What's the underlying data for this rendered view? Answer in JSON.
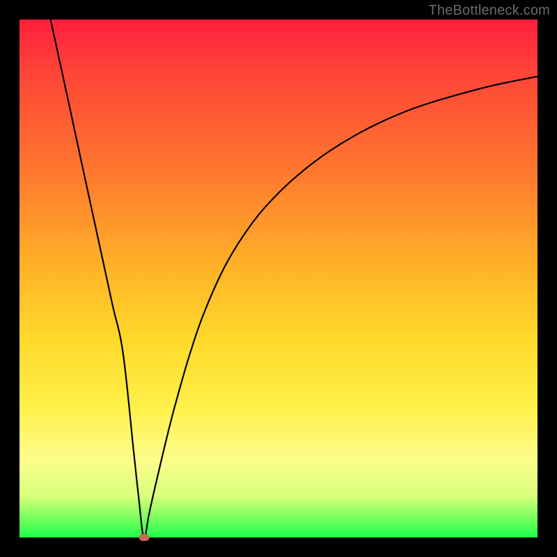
{
  "attribution": "TheBottleneck.com",
  "colors": {
    "frame": "#000000",
    "grad_top": "#ff1f3d",
    "grad_bottom": "#1bff4a",
    "curve": "#000000",
    "marker": "#cc6658"
  },
  "chart_data": {
    "type": "line",
    "title": "",
    "xlabel": "",
    "ylabel": "",
    "x_range": [
      0,
      100
    ],
    "y_range": [
      0,
      100
    ],
    "marker": {
      "x": 24,
      "y": 0
    },
    "series": [
      {
        "name": "bottleneck-curve",
        "x": [
          6,
          8,
          10,
          12,
          14,
          16,
          18,
          20,
          22,
          23,
          24,
          25,
          26,
          28,
          30,
          33,
          36,
          40,
          45,
          50,
          55,
          60,
          66,
          72,
          78,
          85,
          92,
          100
        ],
        "y": [
          100,
          90.8,
          81.6,
          72.3,
          63.1,
          53.9,
          44.7,
          35.5,
          17.0,
          7.8,
          0,
          4.5,
          9.0,
          17.5,
          25.4,
          35.8,
          44.3,
          53.0,
          60.8,
          66.5,
          71.0,
          74.7,
          78.3,
          81.2,
          83.5,
          85.6,
          87.4,
          89.0
        ]
      }
    ]
  }
}
